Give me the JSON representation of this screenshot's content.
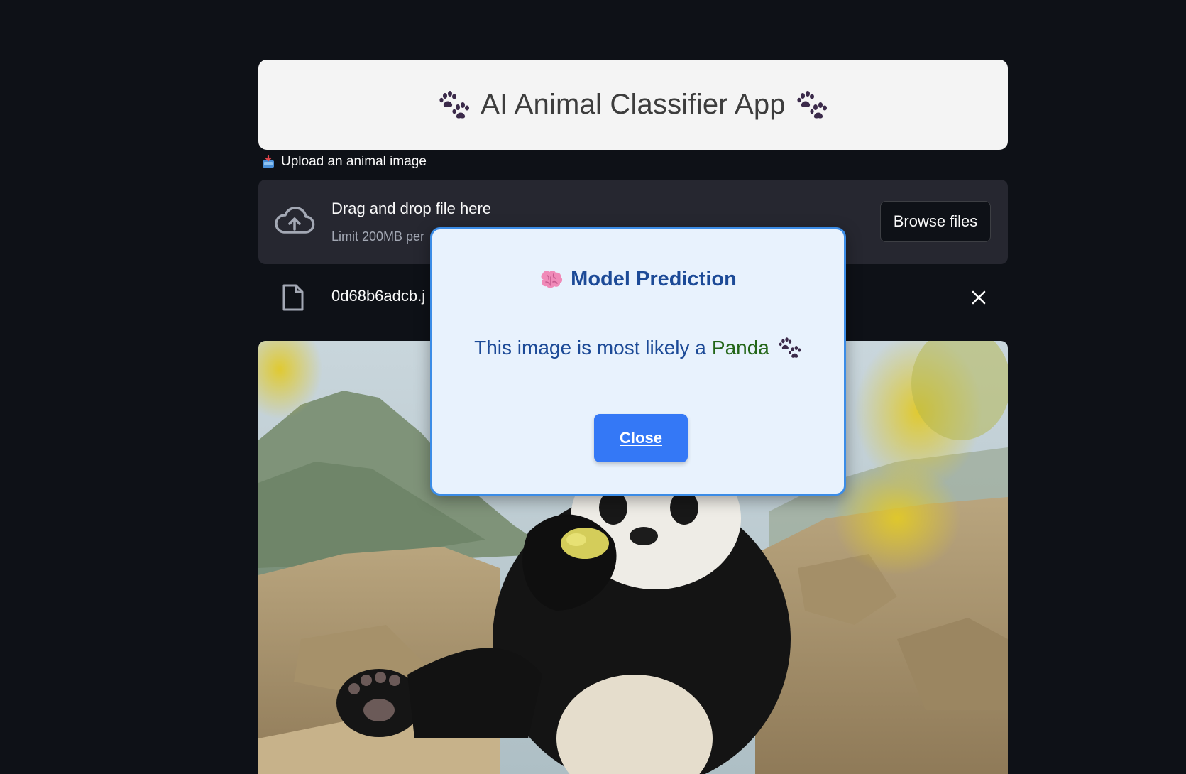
{
  "header": {
    "title": "AI Animal Classifier App",
    "left_icon": "paw-prints-icon",
    "right_icon": "paw-prints-icon"
  },
  "uploader": {
    "label": "Upload an animal image",
    "label_icon": "inbox-tray-icon",
    "drop_title": "Drag and drop file here",
    "drop_limit": "Limit 200MB per",
    "browse_label": "Browse files",
    "cloud_icon": "cloud-upload-icon"
  },
  "file": {
    "name": "0d68b6adcb.j",
    "icon": "file-icon",
    "remove_icon": "close-icon"
  },
  "image": {
    "subject": "panda-photo"
  },
  "modal": {
    "title": "Model Prediction",
    "title_icon": "brain-icon",
    "body_prefix": "This image is most likely a",
    "prediction": "Panda",
    "body_icon": "paw-prints-icon",
    "close_label": "Close",
    "colors": {
      "background": "#e8f2fd",
      "border": "#3b8ce6",
      "text": "#1c4a97",
      "prediction": "#236618",
      "button": "#3478f6"
    }
  },
  "theme": {
    "page_background": "#0e1117",
    "dropzone_background": "#262730",
    "title_card_background": "#f4f4f4"
  }
}
